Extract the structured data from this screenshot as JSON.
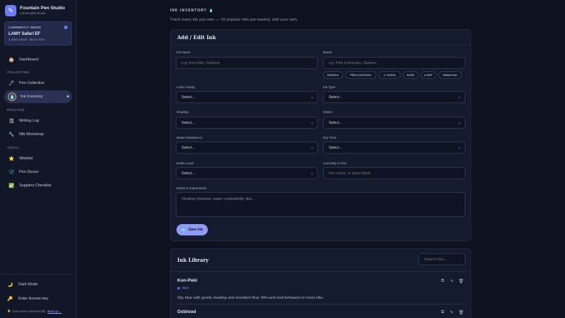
{
  "app": {
    "name": "Fountain Pen Studio",
    "subtitle": "contempl8.studio"
  },
  "currently_inked": {
    "label": "CURRENTLY INKED",
    "pen": "LAMY Safari EF",
    "summary": "4 pens inked · tap to view"
  },
  "sidebar": {
    "dashboard": "Dashboard",
    "sections": {
      "collection": "COLLECTION",
      "practice": "PRACTICE",
      "tools": "TOOLS"
    },
    "items": {
      "pen_collection": "Pen Collection",
      "ink_inventory": "Ink Inventory",
      "writing_log": "Writing Log",
      "nib_workshop": "Nib Workshop",
      "wishlist": "Wishlist",
      "pen_doctor": "Pen Doctor",
      "supplies_checklist": "Supplies Checklist"
    },
    "footer": {
      "dark_mode": "Dark Mode",
      "license": "Enter license key",
      "save_note": "Data saves automatically.",
      "backup_link": "Back up ..."
    }
  },
  "page": {
    "title": "INK INVENTORY",
    "subtitle": "Track every ink you own — 15 popular inks pre-loaded, add your own."
  },
  "form": {
    "heading": "Add / Edit Ink",
    "ink_name_label": "Ink Name",
    "ink_name_placeholder": "e.g. Kon-Peki, Oxblood",
    "brand_label": "Brand",
    "brand_placeholder": "e.g. Pilot Iroshizuku, Diamine",
    "brand_chips": [
      "Diamine",
      "Pilot Iroshizuku",
      "J. Herbin",
      "Sailor",
      "LAMY",
      "Waterman"
    ],
    "color_family_label": "Color Family",
    "ink_type_label": "Ink Type",
    "shading_label": "Shading",
    "sheen_label": "Sheen",
    "water_resistance_label": "Water Resistance",
    "dry_time_label": "Dry Time",
    "bottle_level_label": "Bottle Level",
    "currently_in_pen_label": "Currently In Pen",
    "currently_in_pen_placeholder": "Pen name, or leave blank",
    "notes_label": "Notes & Impressions",
    "notes_placeholder": "Shading character, paper compatibility, tips...",
    "select_default": "Select...",
    "save_button": "Save Ink"
  },
  "library": {
    "heading": "Ink Library",
    "search_placeholder": "Search inks...",
    "inks": [
      {
        "name": "Kon-Peki",
        "color": "Blue",
        "description": "Sky blue with gentle shading and excellent flow. Wet and well-behaved on most nibs."
      },
      {
        "name": "Oxblood"
      }
    ]
  },
  "icons": {
    "brand": "pen-icon",
    "dashboard": "home-icon",
    "pen_collection": "pen-icon",
    "ink_inventory": "ink-bottle-icon",
    "writing_log": "notebook-icon",
    "nib_workshop": "wrench-icon",
    "wishlist": "star-icon",
    "pen_doctor": "stethoscope-icon",
    "supplies_checklist": "checkbox-icon",
    "dark_mode": "moon-icon",
    "license": "key-icon",
    "lock": "lock-icon",
    "duplicate": "copy-icon",
    "edit": "pencil-icon",
    "delete": "trash-icon"
  },
  "colors": {
    "accent": "#8e9cf8",
    "background": "#0e1220",
    "sidebar": "#121728",
    "panel": "#151b2e"
  }
}
